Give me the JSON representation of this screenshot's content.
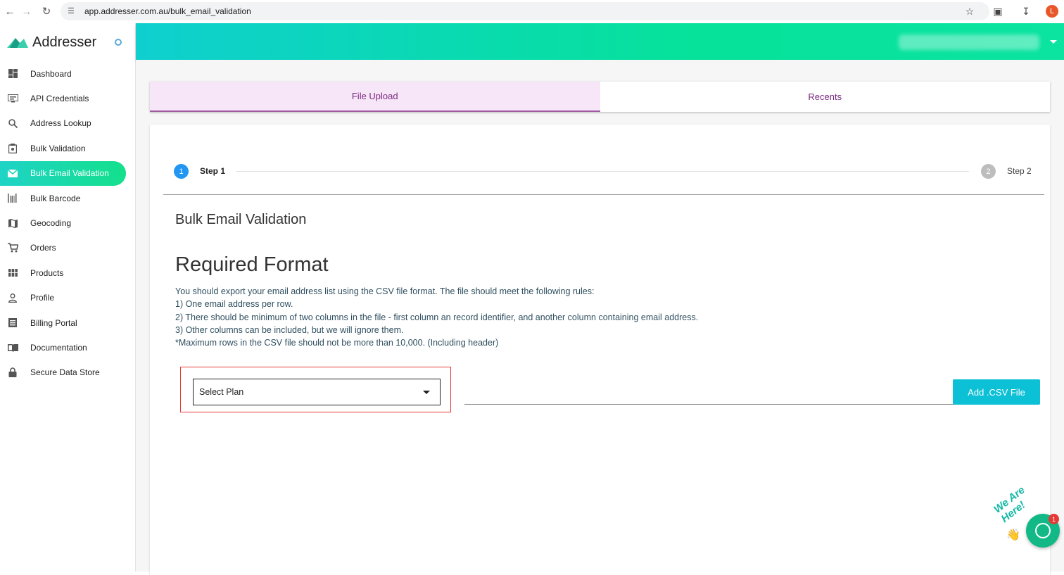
{
  "browser": {
    "url": "app.addresser.com.au/bulk_email_validation",
    "profile_initial": "L"
  },
  "brand": {
    "name": "Addresser",
    "accent_color": "#13e08c"
  },
  "sidebar": {
    "items": [
      {
        "label": "Dashboard",
        "icon": "dashboard-icon"
      },
      {
        "label": "API Credentials",
        "icon": "api-credentials-icon"
      },
      {
        "label": "Address Lookup",
        "icon": "search-icon"
      },
      {
        "label": "Bulk Validation",
        "icon": "bulk-validation-icon"
      },
      {
        "label": "Bulk Email Validation",
        "icon": "mail-icon",
        "active": true
      },
      {
        "label": "Bulk Barcode",
        "icon": "barcode-icon"
      },
      {
        "label": "Geocoding",
        "icon": "map-icon"
      },
      {
        "label": "Orders",
        "icon": "cart-icon"
      },
      {
        "label": "Products",
        "icon": "grid-icon"
      },
      {
        "label": "Profile",
        "icon": "person-icon"
      },
      {
        "label": "Billing Portal",
        "icon": "billing-icon"
      },
      {
        "label": "Documentation",
        "icon": "book-icon"
      },
      {
        "label": "Secure Data Store",
        "icon": "lock-icon"
      }
    ]
  },
  "tabs": [
    {
      "label": "File Upload",
      "active": true
    },
    {
      "label": "Recents",
      "active": false
    }
  ],
  "stepper": {
    "steps": [
      {
        "number": "1",
        "label": "Step 1"
      },
      {
        "number": "2",
        "label": "Step 2"
      }
    ]
  },
  "content": {
    "page_title": "Bulk Email Validation",
    "format_title": "Required Format",
    "rules": [
      "You should export your email address list using the CSV file format. The file should meet the following rules:",
      "1) One email address per row.",
      "2) There should be minimum of two columns in the file - first column an record identifier, and another column containing email address.",
      "3) Other columns can be included, but we will ignore them.",
      "*Maximum rows in the CSV file should not be more than 10,000. (Including header)"
    ],
    "plan_select": "Select Plan",
    "add_csv_button": "Add .CSV File"
  },
  "chat": {
    "label": "We Are Here!",
    "badge": "1"
  }
}
